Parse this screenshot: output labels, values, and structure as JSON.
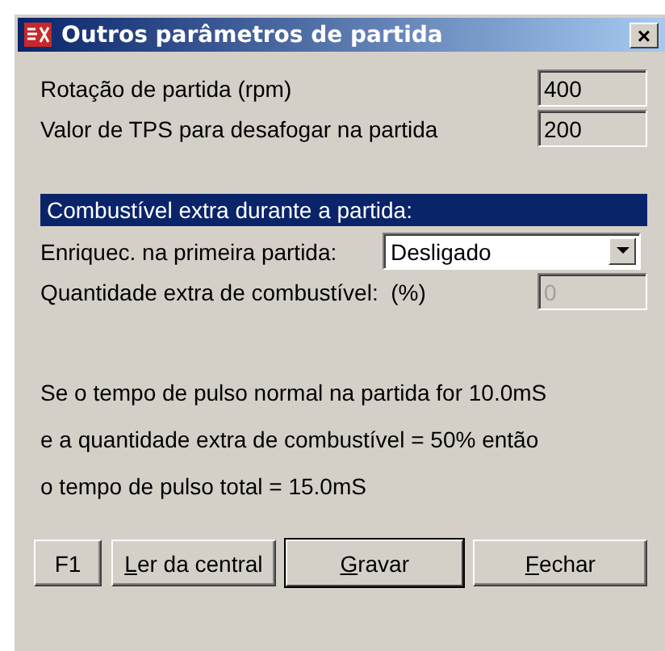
{
  "window": {
    "title": "Outros parâmetros de partida",
    "close": "×"
  },
  "fields": [
    {
      "label": "Rotação de partida (rpm)",
      "value": "400",
      "disabled": false
    },
    {
      "label": "Valor de TPS para desafogar na partida",
      "value": "200",
      "disabled": false
    }
  ],
  "section": {
    "title": "Combustível extra durante a partida:"
  },
  "combo": {
    "label": "Enriquec. na primeira partida:",
    "value": "Desligado"
  },
  "extra": {
    "label": "Quantidade extra de combustível:  (%)",
    "value": "0",
    "disabled": true
  },
  "notes": [
    "Se o tempo de pulso normal na partida for 10.0mS",
    "e a quantidade extra de combustível = 50% então",
    "o tempo de pulso total = 15.0mS"
  ],
  "buttons": [
    {
      "label": "F1",
      "underline_first": false,
      "default": false
    },
    {
      "label": "Ler da central",
      "underline_first": true,
      "default": false
    },
    {
      "label": "Gravar",
      "underline_first": true,
      "default": true
    },
    {
      "label": "Fechar",
      "underline_first": true,
      "default": false
    }
  ]
}
